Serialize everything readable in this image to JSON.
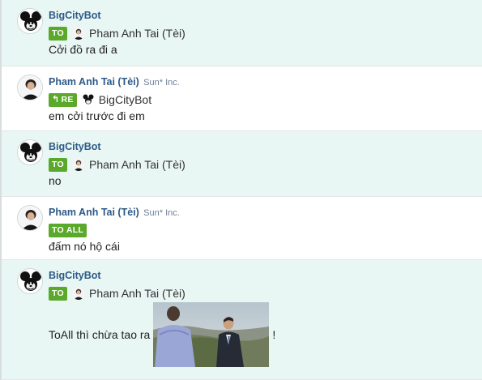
{
  "messages": [
    {
      "sender": "BigCityBot",
      "org": "",
      "badge": "TO",
      "recipient": "Pham Anh Tai (Tèi)",
      "text": "Cởi đồ ra đi a"
    },
    {
      "sender": "Pham Anh Tai (Tèi)",
      "org": "Sun* Inc.",
      "badge": "RE",
      "recipient": "BigCityBot",
      "text": "em cởi trước đi em"
    },
    {
      "sender": "BigCityBot",
      "org": "",
      "badge": "TO",
      "recipient": "Pham Anh Tai (Tèi)",
      "text": "no"
    },
    {
      "sender": "Pham Anh Tai (Tèi)",
      "org": "Sun* Inc.",
      "badge": "TO ALL",
      "recipient": "",
      "text": "đấm nó hộ cái"
    },
    {
      "sender": "BigCityBot",
      "org": "",
      "badge": "TO",
      "recipient": "Pham Anh Tai (Tèi)",
      "text": "ToAll thì chừa tao ra",
      "text_after": "!"
    }
  ],
  "icons": {
    "bot_avatar": "mickey-mouse-avatar",
    "user_avatar": "person-avatar",
    "reply_arrow": "reply-arrow-icon"
  },
  "colors": {
    "mint_bg": "#e8f6f4",
    "badge_green": "#5aa92b",
    "sender_blue": "#2d5a87",
    "org_gray": "#6e7f96"
  }
}
